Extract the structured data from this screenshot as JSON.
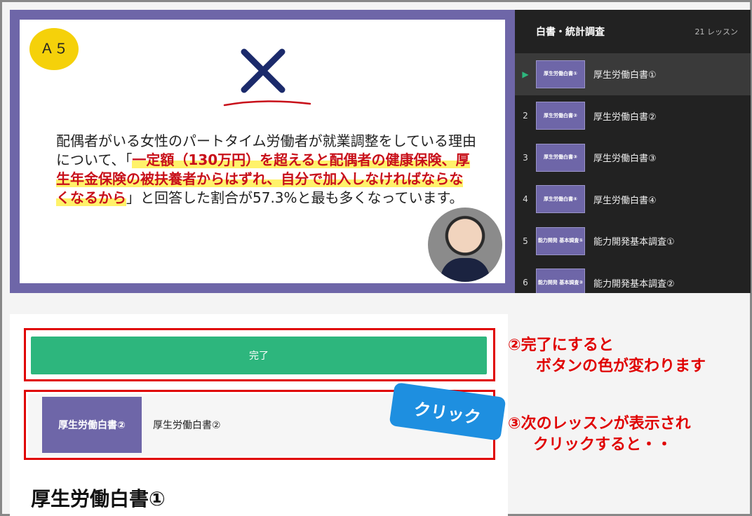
{
  "slide": {
    "badge": "Ａ５",
    "text_before": "配偶者がいる女性のパートタイム労働者が就業調整をしている理由について、「",
    "text_highlight": "一定額（130万円）を超えると配偶者の健康保険、厚生年金保険の被扶養者からはずれ、自分で加入しなければならなくなるから",
    "text_after": "」と回答した割合が57.3%と最も多くなっています。"
  },
  "playlist": {
    "title": "白書・統計調査",
    "count": "21 レッスン",
    "items": [
      {
        "index": "▶",
        "thumb": "厚生労働白書①",
        "label": "厚生労働白書①"
      },
      {
        "index": "2",
        "thumb": "厚生労働白書②",
        "label": "厚生労働白書②"
      },
      {
        "index": "3",
        "thumb": "厚生労働白書③",
        "label": "厚生労働白書③"
      },
      {
        "index": "4",
        "thumb": "厚生労働白書④",
        "label": "厚生労働白書④"
      },
      {
        "index": "5",
        "thumb": "能力開発 基本調査①",
        "label": "能力開発基本調査①"
      },
      {
        "index": "6",
        "thumb": "能力開発 基本調査②",
        "label": "能力開発基本調査②"
      }
    ]
  },
  "main": {
    "complete_label": "完了",
    "next_thumb": "厚生労働白書②",
    "next_label": "厚生労働白書②",
    "click_tag": "クリック",
    "lesson_title": "厚生労働白書①"
  },
  "notes": {
    "note2_line1": "②完了にすると",
    "note2_line2": "ボタンの色が変わります",
    "note3_line1": "③次のレッスンが表示され",
    "note3_line2": "クリックすると・・"
  },
  "colors": {
    "accent_green": "#2db67d",
    "annotation_red": "#e00000",
    "slide_frame": "#6e66a8",
    "click_blue": "#1e8fe0"
  }
}
